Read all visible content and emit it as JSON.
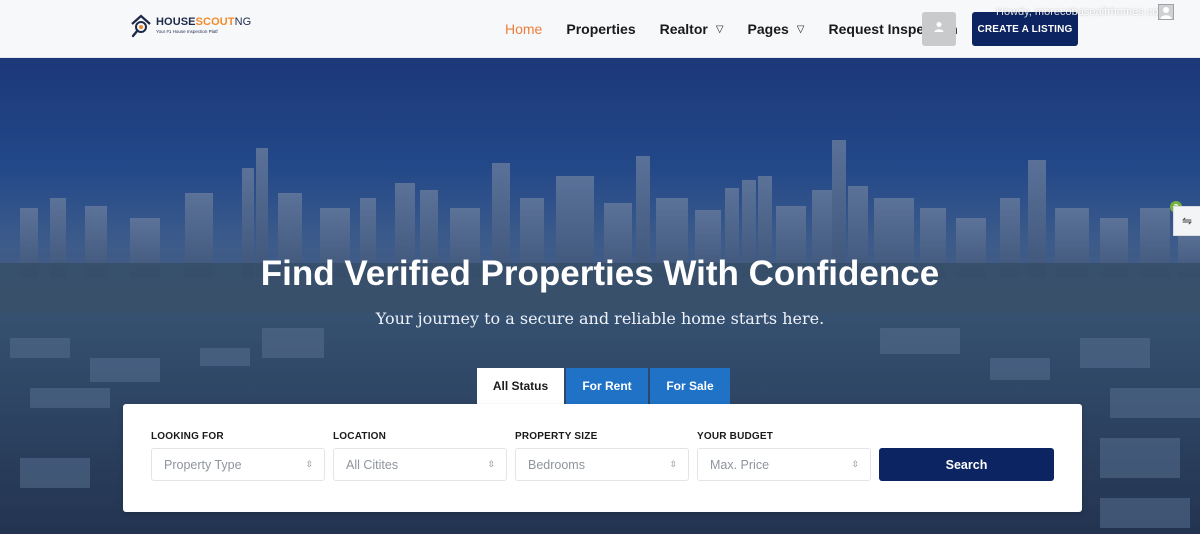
{
  "brand": {
    "name_part1": "HOUSE",
    "name_part2": "SCOUT",
    "name_part3": "NG",
    "tagline": "Your #1 House Inspection Platf",
    "accent_color": "#f28b2b",
    "primary_color": "#0c2461",
    "logo_icon": "house-magnifier-icon"
  },
  "nav": {
    "items": [
      {
        "label": "Home",
        "active": true
      },
      {
        "label": "Properties",
        "active": false
      },
      {
        "label": "Realtor",
        "active": false,
        "dropdown": true
      },
      {
        "label": "Pages",
        "active": false,
        "dropdown": true
      },
      {
        "label": "Request Inspection",
        "active": false
      }
    ],
    "caret_glyph": "▽",
    "user_icon": "user-icon",
    "cta_label": "CREATE A LISTING"
  },
  "adminbar": {
    "howdy": "Howdy, morecobaseaifrhomes.com"
  },
  "hero": {
    "title": "Find Verified Properties With Confidence",
    "subtitle": "Your journey to a secure and reliable home starts here."
  },
  "tabs": [
    {
      "label": "All Status",
      "active": true
    },
    {
      "label": "For Rent",
      "active": false
    },
    {
      "label": "For Sale",
      "active": false
    }
  ],
  "search": {
    "fields": [
      {
        "label": "LOOKING FOR",
        "placeholder": "Property Type"
      },
      {
        "label": "LOCATION",
        "placeholder": "All Citites"
      },
      {
        "label": "PROPERTY SIZE",
        "placeholder": "Bedrooms"
      },
      {
        "label": "YOUR BUDGET",
        "placeholder": "Max. Price"
      }
    ],
    "button_label": "Search"
  },
  "side_widget": {
    "badge": "2",
    "icon": "swap-arrows-icon",
    "glyph": "⇋"
  }
}
